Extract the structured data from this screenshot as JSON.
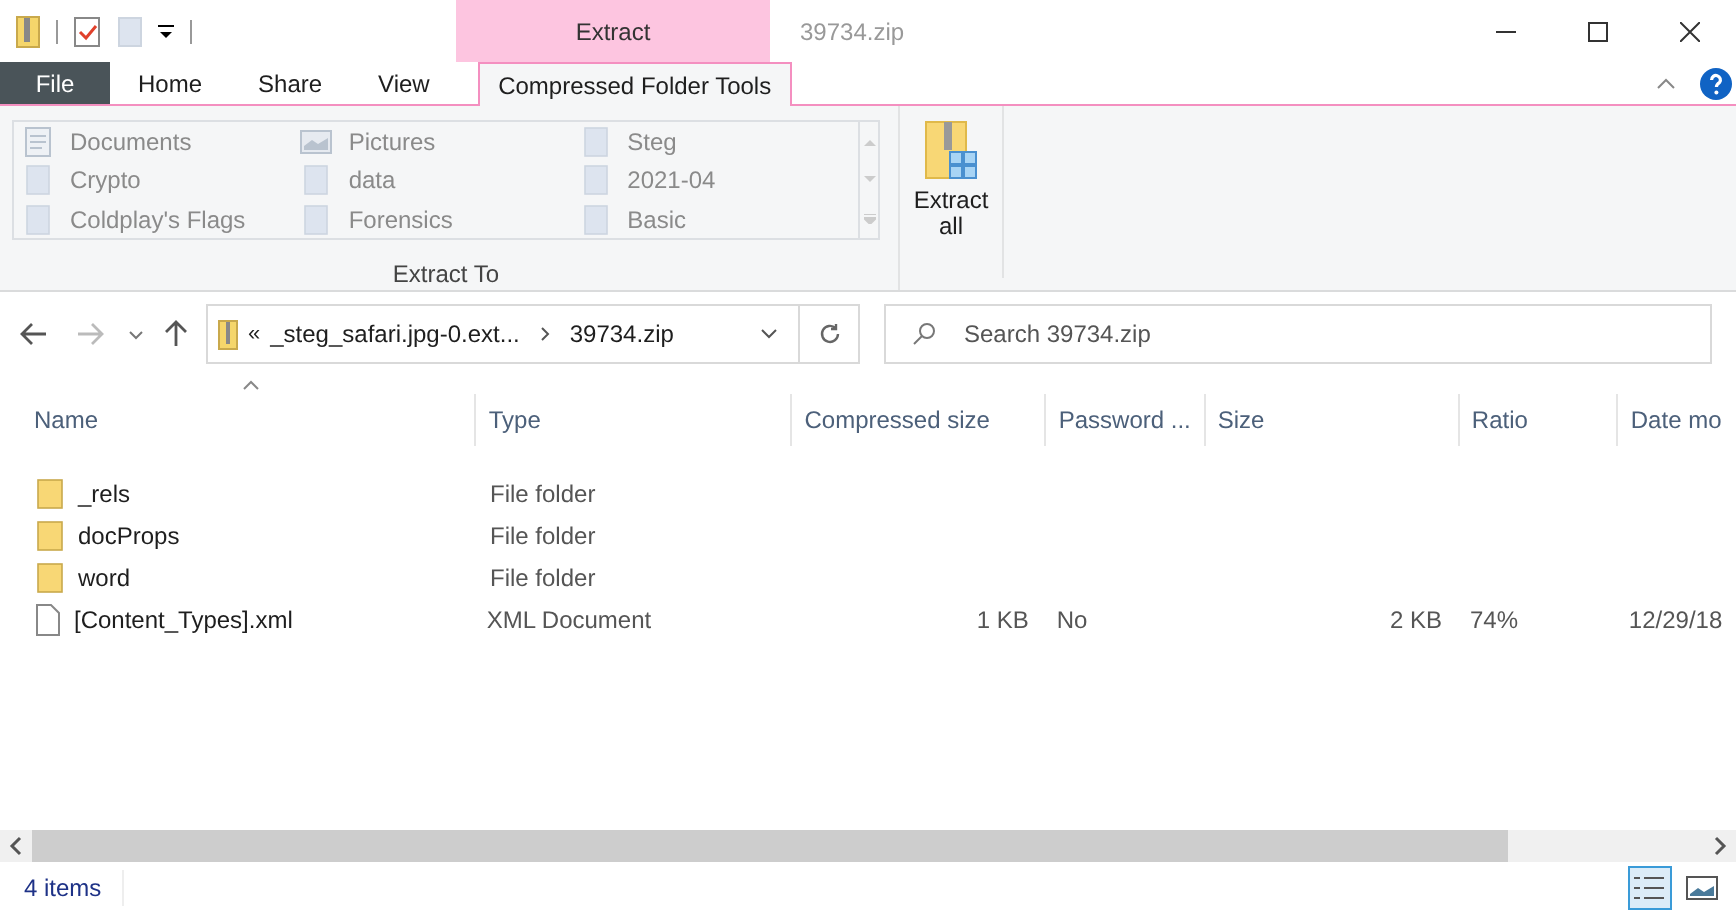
{
  "window": {
    "title": "39734.zip",
    "context_tab": "Extract"
  },
  "ribbon_tabs": [
    {
      "label": "File",
      "kind": "file",
      "selected": false
    },
    {
      "label": "Home",
      "kind": "tab",
      "selected": false
    },
    {
      "label": "Share",
      "kind": "tab",
      "selected": false
    },
    {
      "label": "View",
      "kind": "tab",
      "selected": false
    },
    {
      "label": "Compressed Folder Tools",
      "kind": "tab",
      "selected": true
    }
  ],
  "extract_to": {
    "label": "Extract To",
    "items": [
      {
        "label": "Documents",
        "kind": "document"
      },
      {
        "label": "Crypto",
        "kind": "folder"
      },
      {
        "label": "Coldplay's Flags",
        "kind": "folder"
      },
      {
        "label": "Pictures",
        "kind": "pictures"
      },
      {
        "label": "data",
        "kind": "folder"
      },
      {
        "label": "Forensics",
        "kind": "folder"
      },
      {
        "label": "Steg",
        "kind": "folder"
      },
      {
        "label": "2021-04",
        "kind": "folder"
      },
      {
        "label": "Basic",
        "kind": "folder"
      }
    ]
  },
  "extract_all": {
    "label": "Extract all"
  },
  "address": {
    "overflow": "«",
    "path": [
      "_steg_safari.jpg-0.ext...",
      "39734.zip"
    ]
  },
  "search": {
    "placeholder": "Search 39734.zip"
  },
  "table": {
    "columns": [
      {
        "label": "Name",
        "sorted": true
      },
      {
        "label": "Type",
        "sorted": false
      },
      {
        "label": "Compressed size",
        "sorted": false
      },
      {
        "label": "Password ...",
        "sorted": false
      },
      {
        "label": "Size",
        "sorted": false
      },
      {
        "label": "Ratio",
        "sorted": false
      },
      {
        "label": "Date mo",
        "sorted": false
      }
    ],
    "rows": [
      {
        "kind": "folder",
        "cells": [
          "_rels",
          "File folder"
        ]
      },
      {
        "kind": "folder",
        "cells": [
          "docProps",
          "File folder"
        ]
      },
      {
        "kind": "folder",
        "cells": [
          "word",
          "File folder"
        ]
      },
      {
        "kind": "file",
        "cells": [
          "[Content_Types].xml",
          "XML Document",
          "1 KB",
          "No",
          "2 KB",
          "74%",
          "12/29/18"
        ]
      }
    ]
  },
  "status_bar": {
    "count": "4 items",
    "views": [
      {
        "kind": "details",
        "selected": true
      },
      {
        "kind": "tiles",
        "selected": false
      }
    ]
  }
}
